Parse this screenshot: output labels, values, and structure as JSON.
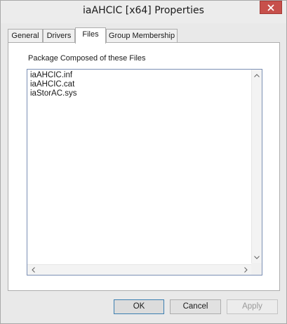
{
  "window": {
    "title": "iaAHCIC [x64] Properties"
  },
  "tabs": [
    {
      "label": "General"
    },
    {
      "label": "Drivers"
    },
    {
      "label": "Files"
    },
    {
      "label": "Group Membership"
    }
  ],
  "active_tab": "Files",
  "files_panel": {
    "label": "Package Composed of these Files",
    "files": [
      "iaAHCIC.inf",
      "iaAHCIC.cat",
      "iaStorAC.sys"
    ]
  },
  "buttons": {
    "ok": "OK",
    "cancel": "Cancel",
    "apply": "Apply"
  },
  "colors": {
    "close_button": "#c7504b",
    "default_button_border": "#3c7fb1",
    "listbox_border": "#7a8fb4"
  }
}
